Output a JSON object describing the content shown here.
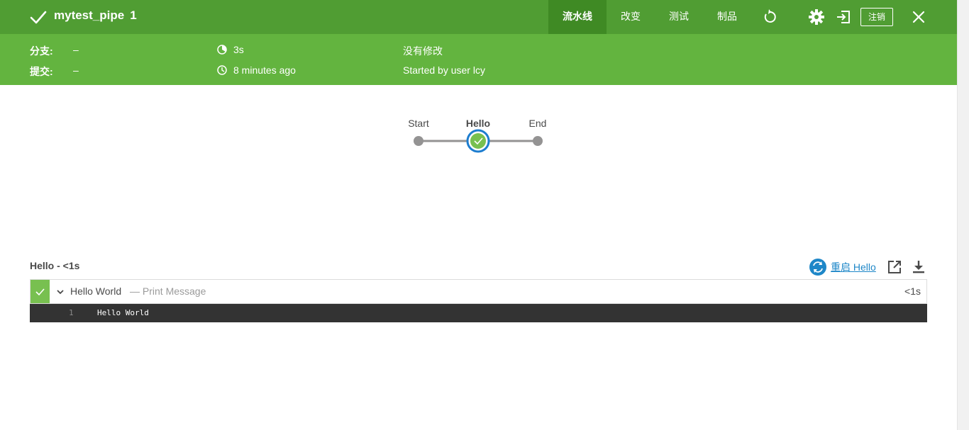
{
  "header": {
    "pipeline_name": "mytest_pipe",
    "run_number": "1",
    "tabs": [
      {
        "label": "流水线",
        "active": true
      },
      {
        "label": "改变",
        "active": false
      },
      {
        "label": "测试",
        "active": false
      },
      {
        "label": "制品",
        "active": false
      }
    ],
    "logout_label": "注销",
    "colors": {
      "primary": "#509d33",
      "secondary": "#63b43f",
      "active_tab": "#3f8a24"
    }
  },
  "info": {
    "branch_label": "分支:",
    "branch_value": "–",
    "commit_label": "提交:",
    "commit_value": "–",
    "duration": "3s",
    "time_ago": "8 minutes ago",
    "changes": "没有修改",
    "started_by": "Started by user lcy"
  },
  "graph": {
    "stages": [
      {
        "label": "Start",
        "status": "none"
      },
      {
        "label": "Hello",
        "status": "success",
        "selected": true
      },
      {
        "label": "End",
        "status": "none"
      }
    ]
  },
  "detail": {
    "stage_title": "Hello - <1s",
    "restart_label": "重启 Hello",
    "steps": [
      {
        "name": "Hello World",
        "description": "— Print Message",
        "duration": "<1s",
        "status": "success"
      }
    ],
    "log_lines": [
      {
        "number": "1",
        "text": "Hello World"
      }
    ]
  }
}
